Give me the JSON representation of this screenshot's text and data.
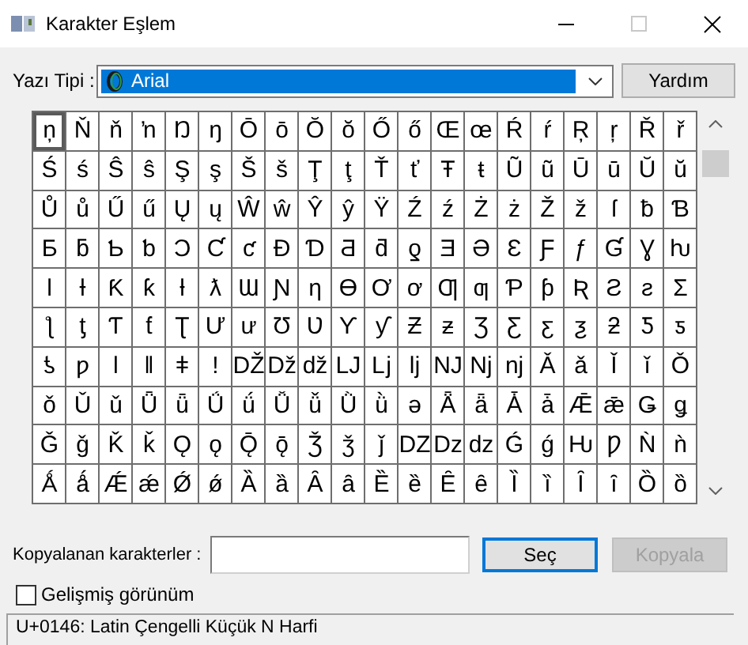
{
  "window": {
    "title": "Karakter Eşlem"
  },
  "font": {
    "label": "Yazı Tipi :",
    "value": "Arial"
  },
  "help_button": "Yardım",
  "grid": {
    "rows": [
      [
        {
          "char": "ņ",
          "selected": true
        },
        {
          "char": "Ň",
          "selected": false
        },
        {
          "char": "ň",
          "selected": false
        },
        {
          "char": "ŉ",
          "selected": false
        },
        {
          "char": "Ŋ",
          "selected": false
        },
        {
          "char": "ŋ",
          "selected": false
        },
        {
          "char": "Ō",
          "selected": false
        },
        {
          "char": "ō",
          "selected": false
        },
        {
          "char": "Ŏ",
          "selected": false
        },
        {
          "char": "ŏ",
          "selected": false
        },
        {
          "char": "Ő",
          "selected": false
        },
        {
          "char": "ő",
          "selected": false
        },
        {
          "char": "Œ",
          "selected": false
        },
        {
          "char": "œ",
          "selected": false
        },
        {
          "char": "Ŕ",
          "selected": false
        },
        {
          "char": "ŕ",
          "selected": false
        },
        {
          "char": "Ŗ",
          "selected": false
        },
        {
          "char": "ŗ",
          "selected": false
        },
        {
          "char": "Ř",
          "selected": false
        },
        {
          "char": "ř",
          "selected": false
        }
      ],
      [
        {
          "char": "Ś",
          "selected": false
        },
        {
          "char": "ś",
          "selected": false
        },
        {
          "char": "Ŝ",
          "selected": false
        },
        {
          "char": "ŝ",
          "selected": false
        },
        {
          "char": "Ş",
          "selected": false
        },
        {
          "char": "ş",
          "selected": false
        },
        {
          "char": "Š",
          "selected": false
        },
        {
          "char": "š",
          "selected": false
        },
        {
          "char": "Ţ",
          "selected": false
        },
        {
          "char": "ţ",
          "selected": false
        },
        {
          "char": "Ť",
          "selected": false
        },
        {
          "char": "ť",
          "selected": false
        },
        {
          "char": "Ŧ",
          "selected": false
        },
        {
          "char": "ŧ",
          "selected": false
        },
        {
          "char": "Ũ",
          "selected": false
        },
        {
          "char": "ũ",
          "selected": false
        },
        {
          "char": "Ū",
          "selected": false
        },
        {
          "char": "ū",
          "selected": false
        },
        {
          "char": "Ŭ",
          "selected": false
        },
        {
          "char": "ŭ",
          "selected": false
        }
      ],
      [
        {
          "char": "Ů",
          "selected": false
        },
        {
          "char": "ů",
          "selected": false
        },
        {
          "char": "Ű",
          "selected": false
        },
        {
          "char": "ű",
          "selected": false
        },
        {
          "char": "Ų",
          "selected": false
        },
        {
          "char": "ų",
          "selected": false
        },
        {
          "char": "Ŵ",
          "selected": false
        },
        {
          "char": "ŵ",
          "selected": false
        },
        {
          "char": "Ŷ",
          "selected": false
        },
        {
          "char": "ŷ",
          "selected": false
        },
        {
          "char": "Ÿ",
          "selected": false
        },
        {
          "char": "Ź",
          "selected": false
        },
        {
          "char": "ź",
          "selected": false
        },
        {
          "char": "Ż",
          "selected": false
        },
        {
          "char": "ż",
          "selected": false
        },
        {
          "char": "Ž",
          "selected": false
        },
        {
          "char": "ž",
          "selected": false
        },
        {
          "char": "ſ",
          "selected": false
        },
        {
          "char": "ƀ",
          "selected": false
        },
        {
          "char": "Ɓ",
          "selected": false
        }
      ],
      [
        {
          "char": "Ƃ",
          "selected": false
        },
        {
          "char": "ƃ",
          "selected": false
        },
        {
          "char": "Ƅ",
          "selected": false
        },
        {
          "char": "ƅ",
          "selected": false
        },
        {
          "char": "Ɔ",
          "selected": false
        },
        {
          "char": "Ƈ",
          "selected": false
        },
        {
          "char": "ƈ",
          "selected": false
        },
        {
          "char": "Ɖ",
          "selected": false
        },
        {
          "char": "Ɗ",
          "selected": false
        },
        {
          "char": "Ƌ",
          "selected": false
        },
        {
          "char": "ƌ",
          "selected": false
        },
        {
          "char": "ƍ",
          "selected": false
        },
        {
          "char": "Ǝ",
          "selected": false
        },
        {
          "char": "Ə",
          "selected": false
        },
        {
          "char": "Ɛ",
          "selected": false
        },
        {
          "char": "Ƒ",
          "selected": false
        },
        {
          "char": "ƒ",
          "selected": false
        },
        {
          "char": "Ɠ",
          "selected": false
        },
        {
          "char": "Ɣ",
          "selected": false
        },
        {
          "char": "ƕ",
          "selected": false
        }
      ],
      [
        {
          "char": "Ɩ",
          "selected": false
        },
        {
          "char": "Ɨ",
          "selected": false
        },
        {
          "char": "Ƙ",
          "selected": false
        },
        {
          "char": "ƙ",
          "selected": false
        },
        {
          "char": "ƚ",
          "selected": false
        },
        {
          "char": "ƛ",
          "selected": false
        },
        {
          "char": "Ɯ",
          "selected": false
        },
        {
          "char": "Ɲ",
          "selected": false
        },
        {
          "char": "ƞ",
          "selected": false
        },
        {
          "char": "Ɵ",
          "selected": false
        },
        {
          "char": "Ơ",
          "selected": false
        },
        {
          "char": "ơ",
          "selected": false
        },
        {
          "char": "Ƣ",
          "selected": false
        },
        {
          "char": "ƣ",
          "selected": false
        },
        {
          "char": "Ƥ",
          "selected": false
        },
        {
          "char": "ƥ",
          "selected": false
        },
        {
          "char": "Ʀ",
          "selected": false
        },
        {
          "char": "Ƨ",
          "selected": false
        },
        {
          "char": "ƨ",
          "selected": false
        },
        {
          "char": "Ʃ",
          "selected": false
        }
      ],
      [
        {
          "char": "ƪ",
          "selected": false
        },
        {
          "char": "ƫ",
          "selected": false
        },
        {
          "char": "Ƭ",
          "selected": false
        },
        {
          "char": "ƭ",
          "selected": false
        },
        {
          "char": "Ʈ",
          "selected": false
        },
        {
          "char": "Ư",
          "selected": false
        },
        {
          "char": "ư",
          "selected": false
        },
        {
          "char": "Ʊ",
          "selected": false
        },
        {
          "char": "Ʋ",
          "selected": false
        },
        {
          "char": "Ƴ",
          "selected": false
        },
        {
          "char": "ƴ",
          "selected": false
        },
        {
          "char": "Ƶ",
          "selected": false
        },
        {
          "char": "ƶ",
          "selected": false
        },
        {
          "char": "Ʒ",
          "selected": false
        },
        {
          "char": "Ƹ",
          "selected": false
        },
        {
          "char": "ƹ",
          "selected": false
        },
        {
          "char": "ƺ",
          "selected": false
        },
        {
          "char": "ƻ",
          "selected": false
        },
        {
          "char": "Ƽ",
          "selected": false
        },
        {
          "char": "ƽ",
          "selected": false
        }
      ],
      [
        {
          "char": "ƾ",
          "selected": false
        },
        {
          "char": "ƿ",
          "selected": false
        },
        {
          "char": "ǀ",
          "selected": false
        },
        {
          "char": "ǁ",
          "selected": false
        },
        {
          "char": "ǂ",
          "selected": false
        },
        {
          "char": "ǃ",
          "selected": false
        },
        {
          "char": "Ǆ",
          "selected": false
        },
        {
          "char": "ǅ",
          "selected": false
        },
        {
          "char": "ǆ",
          "selected": false
        },
        {
          "char": "Ǉ",
          "selected": false
        },
        {
          "char": "ǈ",
          "selected": false
        },
        {
          "char": "ǉ",
          "selected": false
        },
        {
          "char": "Ǌ",
          "selected": false
        },
        {
          "char": "ǋ",
          "selected": false
        },
        {
          "char": "ǌ",
          "selected": false
        },
        {
          "char": "Ǎ",
          "selected": false
        },
        {
          "char": "ǎ",
          "selected": false
        },
        {
          "char": "Ǐ",
          "selected": false
        },
        {
          "char": "ǐ",
          "selected": false
        },
        {
          "char": "Ǒ",
          "selected": false
        }
      ],
      [
        {
          "char": "ǒ",
          "selected": false
        },
        {
          "char": "Ǔ",
          "selected": false
        },
        {
          "char": "ǔ",
          "selected": false
        },
        {
          "char": "Ǖ",
          "selected": false
        },
        {
          "char": "ǖ",
          "selected": false
        },
        {
          "char": "Ǘ",
          "selected": false
        },
        {
          "char": "ǘ",
          "selected": false
        },
        {
          "char": "Ǚ",
          "selected": false
        },
        {
          "char": "ǚ",
          "selected": false
        },
        {
          "char": "Ǜ",
          "selected": false
        },
        {
          "char": "ǜ",
          "selected": false
        },
        {
          "char": "ǝ",
          "selected": false
        },
        {
          "char": "Ǟ",
          "selected": false
        },
        {
          "char": "ǟ",
          "selected": false
        },
        {
          "char": "Ǡ",
          "selected": false
        },
        {
          "char": "ǡ",
          "selected": false
        },
        {
          "char": "Ǣ",
          "selected": false
        },
        {
          "char": "ǣ",
          "selected": false
        },
        {
          "char": "Ǥ",
          "selected": false
        },
        {
          "char": "ǥ",
          "selected": false
        }
      ],
      [
        {
          "char": "Ǧ",
          "selected": false
        },
        {
          "char": "ǧ",
          "selected": false
        },
        {
          "char": "Ǩ",
          "selected": false
        },
        {
          "char": "ǩ",
          "selected": false
        },
        {
          "char": "Ǫ",
          "selected": false
        },
        {
          "char": "ǫ",
          "selected": false
        },
        {
          "char": "Ǭ",
          "selected": false
        },
        {
          "char": "ǭ",
          "selected": false
        },
        {
          "char": "Ǯ",
          "selected": false
        },
        {
          "char": "ǯ",
          "selected": false
        },
        {
          "char": "ǰ",
          "selected": false
        },
        {
          "char": "Ǳ",
          "selected": false
        },
        {
          "char": "ǲ",
          "selected": false
        },
        {
          "char": "ǳ",
          "selected": false
        },
        {
          "char": "Ǵ",
          "selected": false
        },
        {
          "char": "ǵ",
          "selected": false
        },
        {
          "char": "Ƕ",
          "selected": false
        },
        {
          "char": "Ƿ",
          "selected": false
        },
        {
          "char": "Ǹ",
          "selected": false
        },
        {
          "char": "ǹ",
          "selected": false
        }
      ],
      [
        {
          "char": "Ǻ",
          "selected": false
        },
        {
          "char": "ǻ",
          "selected": false
        },
        {
          "char": "Ǽ",
          "selected": false
        },
        {
          "char": "ǽ",
          "selected": false
        },
        {
          "char": "Ǿ",
          "selected": false
        },
        {
          "char": "ǿ",
          "selected": false
        },
        {
          "char": "Ȁ",
          "selected": false
        },
        {
          "char": "ȁ",
          "selected": false
        },
        {
          "char": "Ȃ",
          "selected": false
        },
        {
          "char": "ȃ",
          "selected": false
        },
        {
          "char": "Ȅ",
          "selected": false
        },
        {
          "char": "ȅ",
          "selected": false
        },
        {
          "char": "Ȇ",
          "selected": false
        },
        {
          "char": "ȇ",
          "selected": false
        },
        {
          "char": "Ȉ",
          "selected": false
        },
        {
          "char": "ȉ",
          "selected": false
        },
        {
          "char": "Ȋ",
          "selected": false
        },
        {
          "char": "ȋ",
          "selected": false
        },
        {
          "char": "Ȍ",
          "selected": false
        },
        {
          "char": "ȍ",
          "selected": false
        }
      ]
    ]
  },
  "copy": {
    "label": "Kopyalanan karakterler :"
  },
  "select_button": {
    "label": "Seç",
    "focused": true
  },
  "copy_button": {
    "label": "Kopyala",
    "disabled": true
  },
  "advanced": {
    "label": "Gelişmiş görünüm",
    "checked": false
  },
  "status_bar": "U+0146: Latin Çengelli Küçük N Harfi"
}
